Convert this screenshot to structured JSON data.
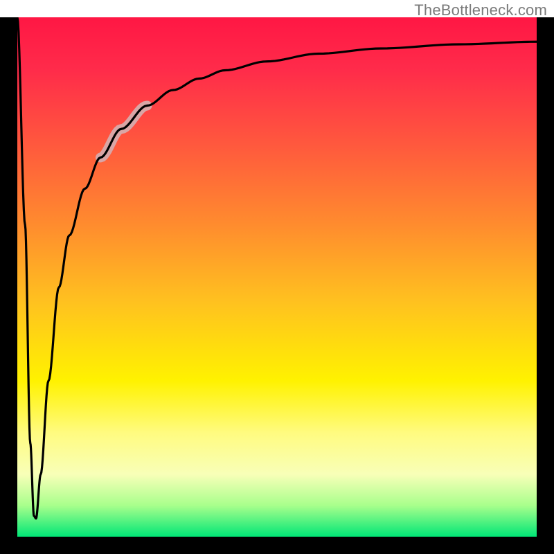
{
  "watermark": "TheBottleneck.com",
  "chart_data": {
    "type": "line",
    "title": "",
    "xlabel": "",
    "ylabel": "",
    "xlim": [
      0,
      100
    ],
    "ylim": [
      0,
      100
    ],
    "grid": false,
    "notes": "Vertical gradient background red→yellow→green; black curve dips sharply near x≈3 then rises asymptotically toward top-right; thick grey highlight on an upper segment.",
    "series": [
      {
        "name": "bottleneck-curve",
        "x": [
          0,
          1.5,
          2.5,
          3.2,
          3.6,
          4.5,
          6,
          8,
          10,
          13,
          16,
          20,
          25,
          30,
          35,
          40,
          48,
          58,
          70,
          85,
          100
        ],
        "y": [
          100,
          60,
          18,
          4,
          3.5,
          12,
          30,
          48,
          58,
          67,
          73,
          78.5,
          83,
          86,
          88.2,
          89.8,
          91.5,
          93,
          94,
          94.8,
          95.3
        ]
      },
      {
        "name": "highlight-segment",
        "x": [
          16,
          25
        ],
        "y": [
          73,
          83
        ]
      }
    ],
    "gradient_stops": [
      {
        "pos": 0.0,
        "color": "#ff1744"
      },
      {
        "pos": 0.1,
        "color": "#ff2b4a"
      },
      {
        "pos": 0.25,
        "color": "#ff5a3d"
      },
      {
        "pos": 0.4,
        "color": "#ff8c2e"
      },
      {
        "pos": 0.55,
        "color": "#ffc21f"
      },
      {
        "pos": 0.7,
        "color": "#fff200"
      },
      {
        "pos": 0.8,
        "color": "#fffb80"
      },
      {
        "pos": 0.88,
        "color": "#f8ffb8"
      },
      {
        "pos": 0.94,
        "color": "#a8ff8c"
      },
      {
        "pos": 1.0,
        "color": "#00e676"
      }
    ]
  }
}
